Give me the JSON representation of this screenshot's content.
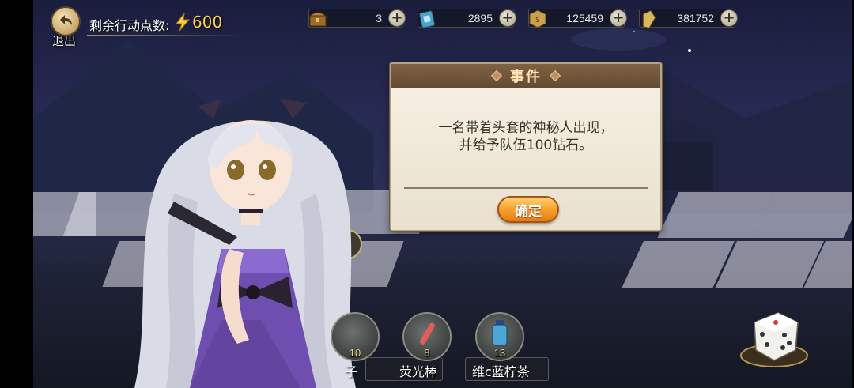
{
  "top_bar": {
    "back_label": "退出",
    "action_points_label": "剩余行动点数:",
    "action_points_value": "600",
    "resources": [
      {
        "icon": "chest-icon",
        "value": "3"
      },
      {
        "icon": "ticket-icon",
        "value": "2895"
      },
      {
        "icon": "coin-icon",
        "value": "125459"
      },
      {
        "icon": "crystal-icon",
        "value": "381752"
      }
    ],
    "plus_symbol": "+"
  },
  "dialog": {
    "title": "事件",
    "message": "一名带着头套的神秘人出现，\n并给予队伍100钻石。",
    "confirm_label": "确定"
  },
  "items": [
    {
      "name": "子",
      "count": "10"
    },
    {
      "name": "荧光棒",
      "count": "8"
    },
    {
      "name": "维c蓝柠茶",
      "count": "13"
    }
  ],
  "colors": {
    "dialog_header": "#6f5339",
    "confirm_button": "#f59a2a",
    "action_points": "#ffd24d"
  }
}
